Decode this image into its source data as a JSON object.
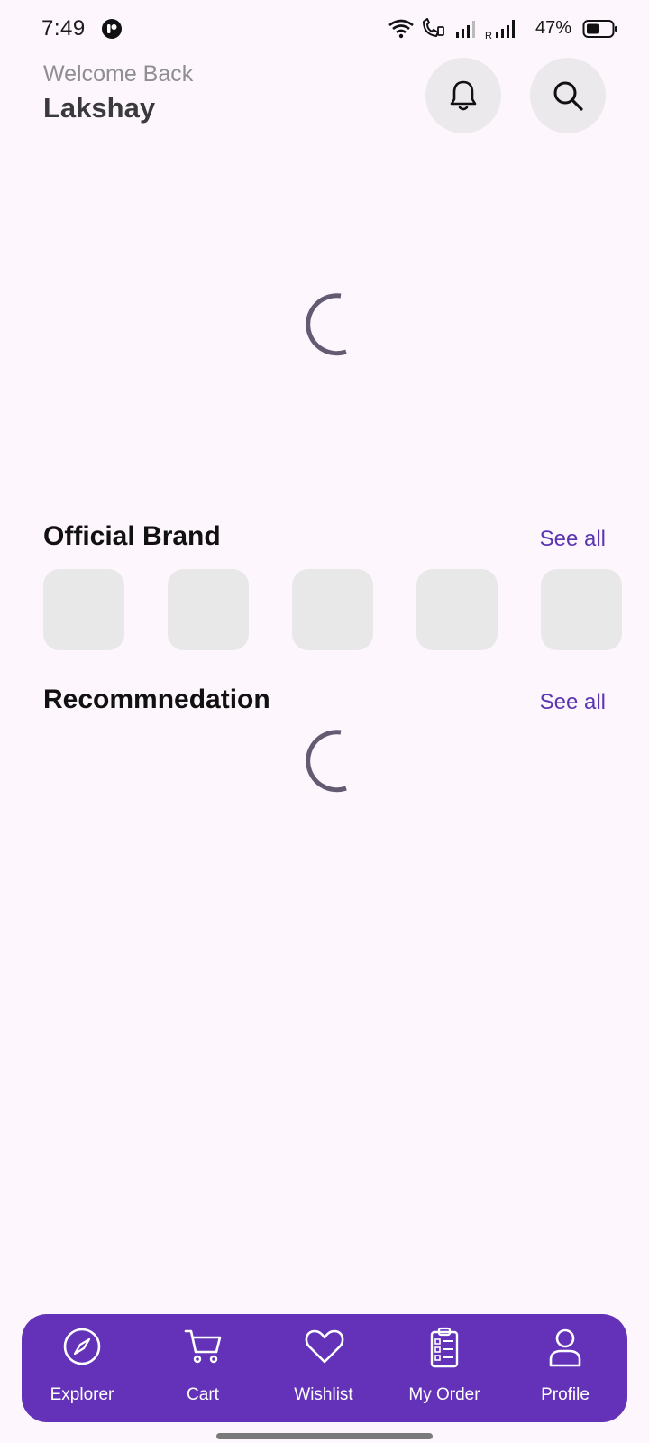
{
  "status_bar": {
    "time": "7:49",
    "battery": "47%",
    "icons": [
      "app-notification-icon",
      "wifi-icon",
      "wifi-calling-icon",
      "signal-icon",
      "roaming-signal-icon",
      "battery-icon"
    ]
  },
  "header": {
    "greeting": "Welcome Back",
    "username": "Lakshay",
    "buttons": [
      "bell-icon",
      "search-icon"
    ]
  },
  "sections": {
    "official_brand": {
      "title": "Official Brand",
      "see_all": "See all",
      "placeholder_count": 5
    },
    "recommendation": {
      "title": "Recommnedation",
      "see_all": "See all"
    }
  },
  "bottom_nav": {
    "items": [
      {
        "label": "Explorer",
        "icon": "compass-icon"
      },
      {
        "label": "Cart",
        "icon": "cart-icon"
      },
      {
        "label": "Wishlist",
        "icon": "heart-icon"
      },
      {
        "label": "My Order",
        "icon": "clipboard-icon"
      },
      {
        "label": "Profile",
        "icon": "user-icon"
      }
    ]
  },
  "colors": {
    "background": "#FDF6FD",
    "accent": "#6332B8",
    "link": "#5B35B0",
    "spinner": "#625B71",
    "placeholder": "#E8E8E8"
  }
}
